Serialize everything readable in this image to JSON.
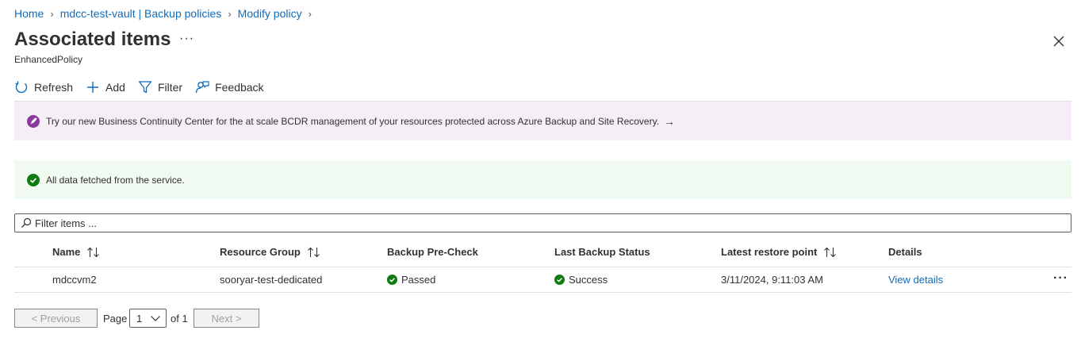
{
  "breadcrumb": {
    "home": "Home",
    "vault": "mdcc-test-vault | Backup policies",
    "modify": "Modify policy"
  },
  "header": {
    "title": "Associated items",
    "more": "···",
    "subtitle": "EnhancedPolicy"
  },
  "toolbar": {
    "refresh": "Refresh",
    "add": "Add",
    "filter": "Filter",
    "feedback": "Feedback"
  },
  "banners": {
    "promo": "Try our new Business Continuity Center for the at scale BCDR management of your resources protected across Azure Backup and Site Recovery.",
    "promo_arrow": "→",
    "status": "All data fetched from the service."
  },
  "filter": {
    "placeholder": "Filter items ..."
  },
  "table": {
    "columns": {
      "name": "Name",
      "resource_group": "Resource Group",
      "precheck": "Backup Pre-Check",
      "last_backup": "Last Backup Status",
      "restore_point": "Latest restore point",
      "details": "Details"
    },
    "rows": [
      {
        "name": "mdccvm2",
        "resource_group": "sooryar-test-dedicated",
        "precheck": "Passed",
        "last_backup": "Success",
        "restore_point": "3/11/2024, 9:11:03 AM",
        "details": "View details",
        "more": "···"
      }
    ]
  },
  "pagination": {
    "previous": "< Previous",
    "page_label": "Page",
    "current_page": "1",
    "of_label": "of 1",
    "next": "Next >"
  },
  "colors": {
    "accent": "#0f6cbd",
    "success": "#107c10",
    "promo_icon": "#8a3a9a",
    "promo_bg": "#f5eef6",
    "success_bg": "#f1faf1"
  }
}
